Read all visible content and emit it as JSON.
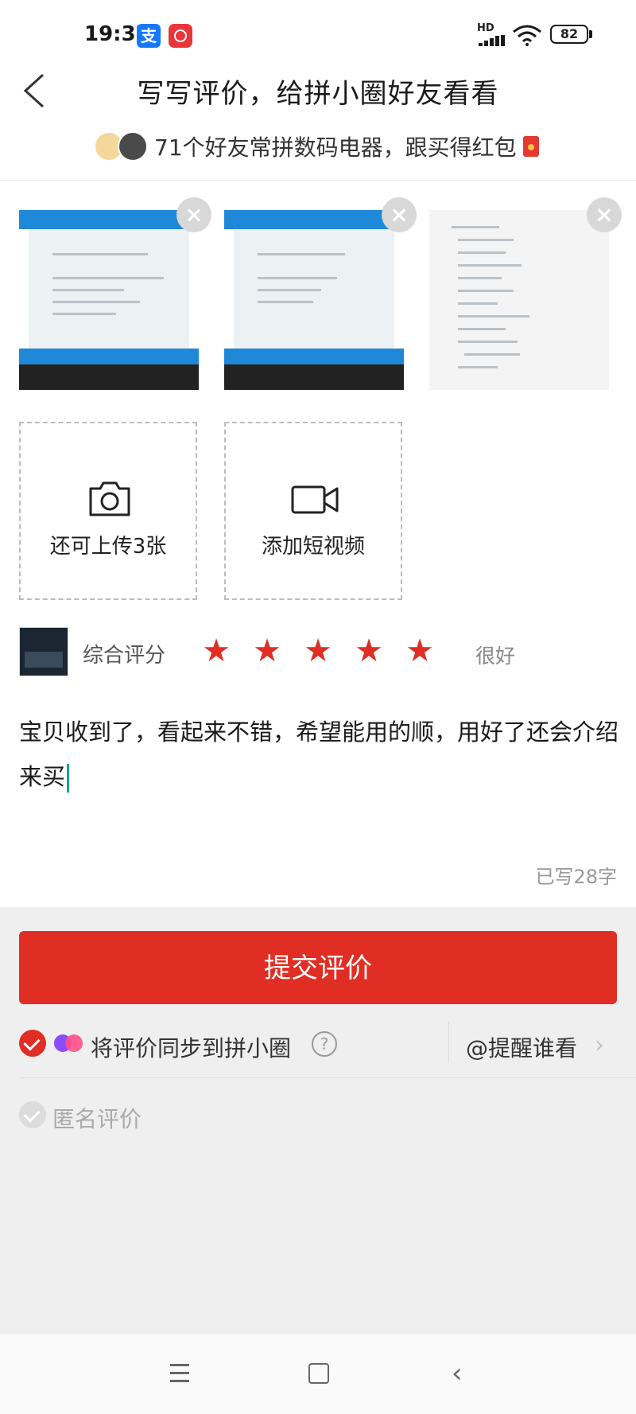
{
  "status_bar": {
    "time": "19:37",
    "alipay_glyph": "支",
    "network": "HD",
    "battery": "82"
  },
  "header": {
    "title": "写写评价，给拼小圈好友看看",
    "friends_text": "71个好友常拼数码电器，跟买得红包"
  },
  "photos": [
    {
      "icon": "screenshot-thumbnail"
    },
    {
      "icon": "screenshot-thumbnail"
    },
    {
      "icon": "device-manager-thumbnail"
    }
  ],
  "upload": {
    "photo_label": "还可上传3张",
    "video_label": "添加短视频"
  },
  "rating": {
    "label": "综合评分",
    "stars": 5,
    "max_stars": 5,
    "text": "很好",
    "star_color": "#e02e24"
  },
  "review": {
    "text": "宝贝收到了，看起来不错，希望能用的顺，用好了还会介绍来买",
    "char_count": "已写28字"
  },
  "actions": {
    "submit_label": "提交评价",
    "sync_label": "将评价同步到拼小圈",
    "help_glyph": "?",
    "remind_label": "@提醒谁看",
    "anonymous_label": "匿名评价"
  },
  "colors": {
    "accent": "#e02e24",
    "background_gray": "#efefef"
  }
}
